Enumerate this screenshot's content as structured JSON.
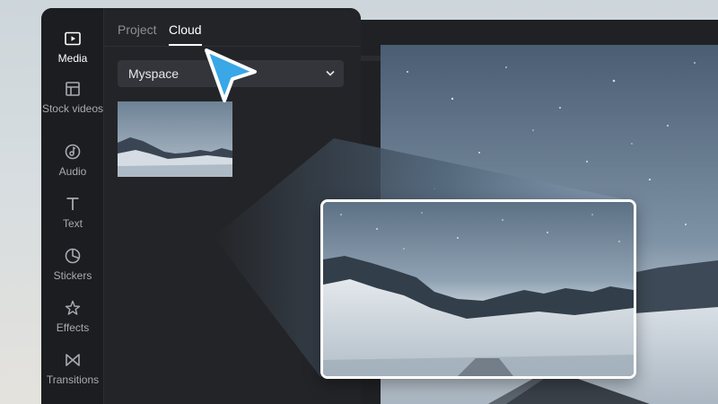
{
  "sidebar": {
    "items": [
      {
        "label": "Media",
        "icon": "play-icon",
        "active": true
      },
      {
        "label": "Stock videos",
        "icon": "layout-icon",
        "active": false
      },
      {
        "label": "Audio",
        "icon": "music-note-icon",
        "active": false
      },
      {
        "label": "Text",
        "icon": "text-icon",
        "active": false
      },
      {
        "label": "Stickers",
        "icon": "sticker-icon",
        "active": false
      },
      {
        "label": "Effects",
        "icon": "sparkle-star-icon",
        "active": false
      },
      {
        "label": "Transitions",
        "icon": "bowtie-transition-icon",
        "active": false
      }
    ]
  },
  "tabs": [
    {
      "label": "Project",
      "active": false
    },
    {
      "label": "Cloud",
      "active": true
    }
  ],
  "space_select": {
    "value": "Myspace"
  },
  "colors": {
    "panel": "#232427",
    "rail": "#1c1d20",
    "cursor": "#3aa7e6",
    "callout_border": "#ffffff"
  }
}
